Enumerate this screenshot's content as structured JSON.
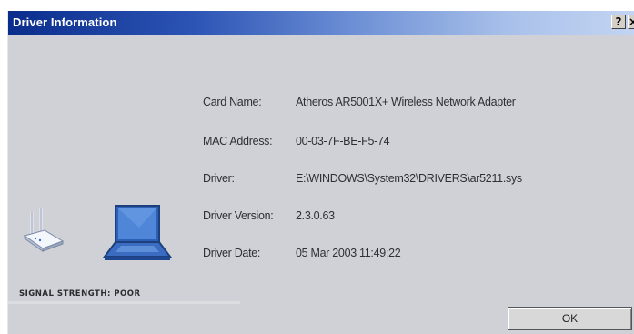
{
  "window": {
    "title": "Driver Information",
    "help_glyph": "?",
    "close_glyph": "×"
  },
  "fields": [
    {
      "label": "Card Name:",
      "value": "Atheros AR5001X+ Wireless Network Adapter"
    },
    {
      "label": "MAC Address:",
      "value": "00-03-7F-BE-F5-74"
    },
    {
      "label": "Driver:",
      "value": "E:\\WINDOWS\\System32\\DRIVERS\\ar5211.sys"
    },
    {
      "label": "Driver Version:",
      "value": "2.3.0.63"
    },
    {
      "label": "Driver Date:",
      "value": "05 Mar 2003 11:49:22"
    }
  ],
  "signal": {
    "text": "SIGNAL STRENGTH: POOR"
  },
  "buttons": {
    "ok_label": "OK"
  },
  "icons": {
    "router": "wireless-router-icon",
    "laptop": "laptop-icon"
  },
  "colors": {
    "titlebar_start": "#0a2d8c",
    "titlebar_end": "#c3d4f2",
    "dialog_bg": "#cfd1d6",
    "text": "#2e3036"
  }
}
